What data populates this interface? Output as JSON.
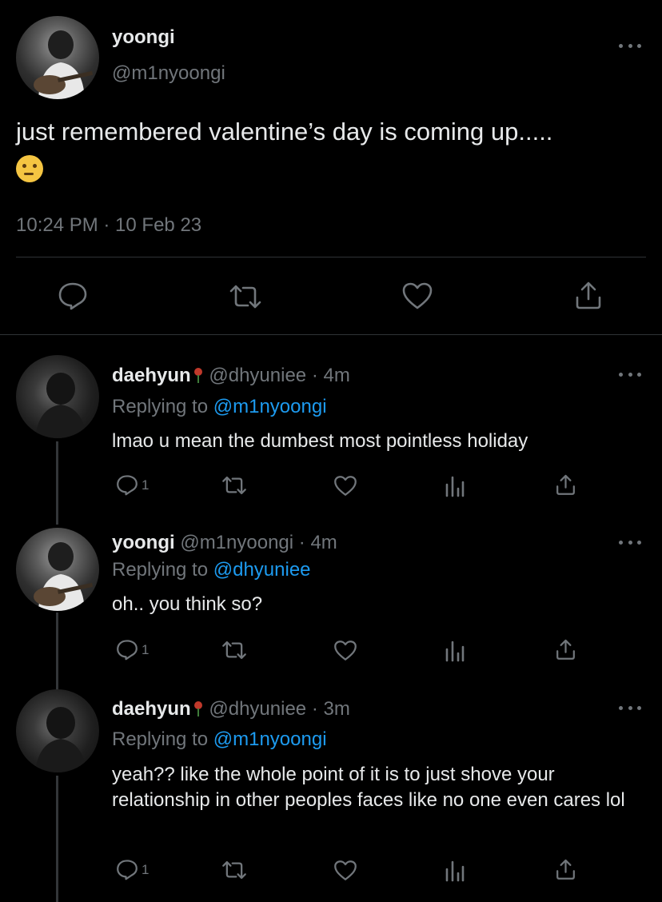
{
  "main_tweet": {
    "name": "yoongi",
    "handle": "@m1nyoongi",
    "text": "just remembered valentine’s day is coming up.....",
    "emoji_icon": "thinking-face-icon",
    "timestamp": "10:24 PM · 10 Feb 23",
    "actions": [
      "reply-icon",
      "retweet-icon",
      "like-icon",
      "share-icon"
    ]
  },
  "replies": [
    {
      "name": "daehyun",
      "name_emoji": "rose-icon",
      "handle": "@dhyuniee",
      "time": "· 4m",
      "replying_label": "Replying to",
      "replying_to": "@m1nyoongi",
      "text": "lmao u mean the dumbest most pointless holiday",
      "reply_count": "1"
    },
    {
      "name": "yoongi",
      "handle": "@m1nyoongi",
      "time": "· 4m",
      "replying_label": "Replying to",
      "replying_to": "@dhyuniee",
      "text": "oh.. you think so?",
      "reply_count": "1"
    },
    {
      "name": "daehyun",
      "name_emoji": "rose-icon",
      "handle": "@dhyuniee",
      "time": "· 3m",
      "replying_label": "Replying to",
      "replying_to": "@m1nyoongi",
      "text": "yeah?? like the whole point of it is to just shove your relationship in other peoples faces like no one even cares lol",
      "reply_count": "1"
    }
  ],
  "colors": {
    "background": "#000000",
    "text": "#e7e9ea",
    "muted": "#71767b",
    "link": "#1d9bf0",
    "divider": "#2f3336"
  }
}
